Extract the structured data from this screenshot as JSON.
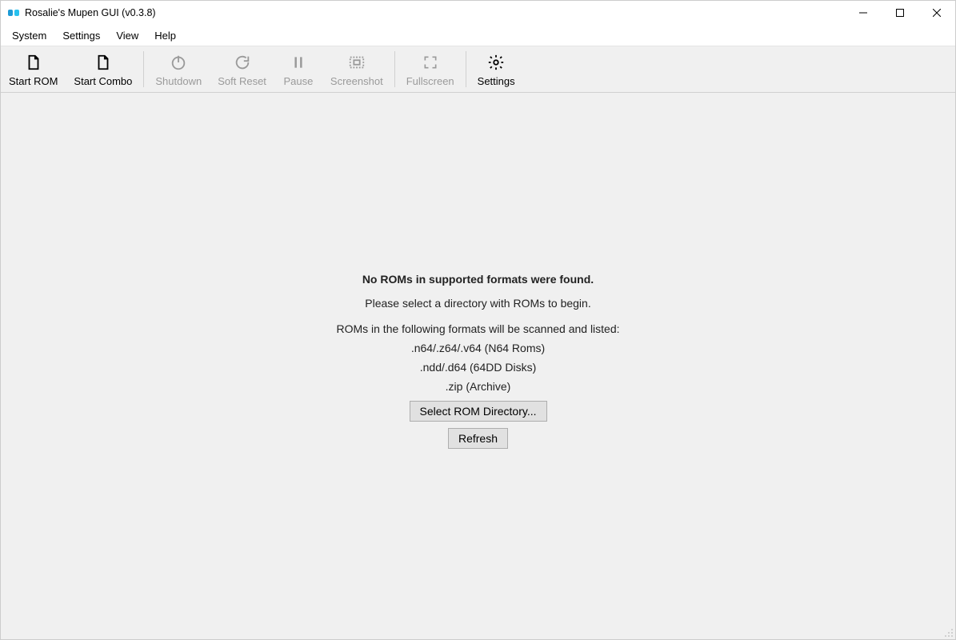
{
  "window": {
    "title": "Rosalie's Mupen GUI (v0.3.8)"
  },
  "menubar": {
    "items": [
      {
        "label": "System"
      },
      {
        "label": "Settings"
      },
      {
        "label": "View"
      },
      {
        "label": "Help"
      }
    ]
  },
  "toolbar": {
    "buttons": [
      {
        "label": "Start ROM",
        "icon": "file",
        "enabled": true
      },
      {
        "label": "Start Combo",
        "icon": "file",
        "enabled": true
      },
      {
        "label": "Shutdown",
        "icon": "power",
        "enabled": false
      },
      {
        "label": "Soft Reset",
        "icon": "refresh",
        "enabled": false
      },
      {
        "label": "Pause",
        "icon": "pause",
        "enabled": false
      },
      {
        "label": "Screenshot",
        "icon": "screenshot",
        "enabled": false
      },
      {
        "label": "Fullscreen",
        "icon": "fullscreen",
        "enabled": false
      },
      {
        "label": "Settings",
        "icon": "gear",
        "enabled": true
      }
    ]
  },
  "main": {
    "headline": "No ROMs in supported formats were found.",
    "subline": "Please select a directory with ROMs to begin.",
    "formats_intro": "ROMs in the following formats will be scanned and listed:",
    "formats": [
      ".n64/.z64/.v64 (N64 Roms)",
      ".ndd/.d64 (64DD Disks)",
      ".zip (Archive)"
    ],
    "select_button": "Select ROM Directory...",
    "refresh_button": "Refresh"
  }
}
